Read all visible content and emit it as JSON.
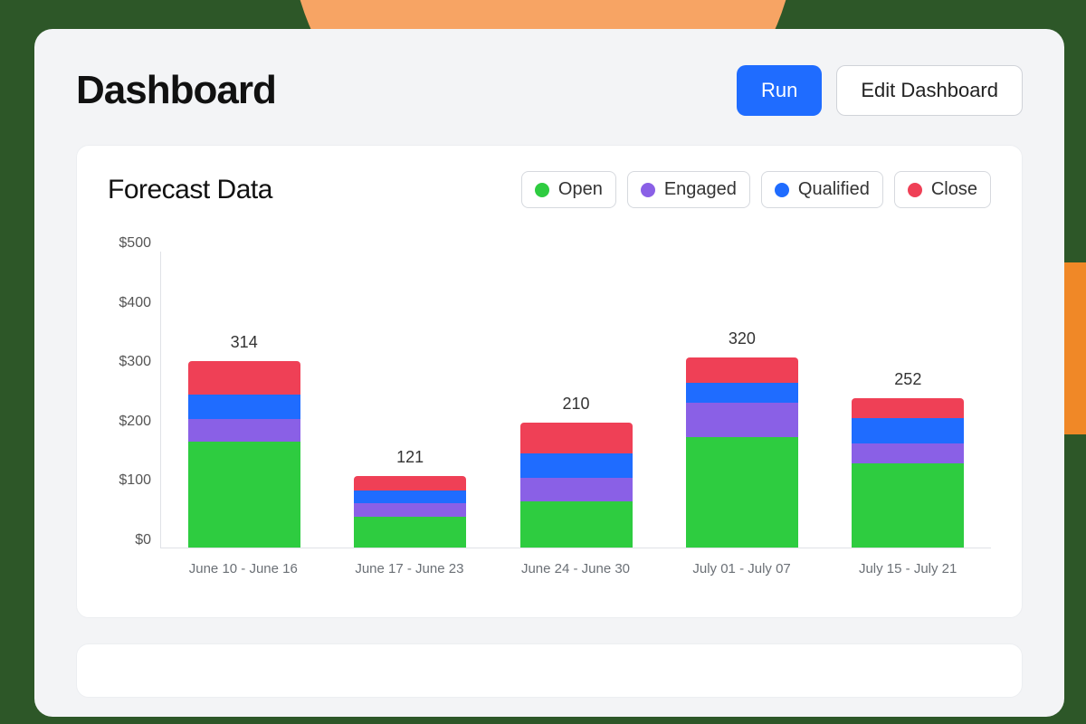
{
  "header": {
    "title": "Dashboard",
    "run_label": "Run",
    "edit_label": "Edit Dashboard"
  },
  "chart": {
    "title": "Forecast Data",
    "legend": [
      {
        "name": "Open",
        "color": "#2ecc40"
      },
      {
        "name": "Engaged",
        "color": "#8a60e6"
      },
      {
        "name": "Qualified",
        "color": "#1f6cff"
      },
      {
        "name": "Close",
        "color": "#ef4056"
      }
    ],
    "y_ticks": [
      "$500",
      "$400",
      "$300",
      "$200",
      "$100",
      "$0"
    ]
  },
  "chart_data": {
    "type": "bar",
    "title": "Forecast Data",
    "xlabel": "",
    "ylabel": "",
    "ylim": [
      0,
      500
    ],
    "categories": [
      "June 10 - June 16",
      "June 17 - June 23",
      "June 24 - June 30",
      "July 01 - July 07",
      "July 15 - July 21"
    ],
    "totals": [
      314,
      121,
      210,
      320,
      252
    ],
    "series": [
      {
        "name": "Open",
        "color": "#2ecc40",
        "values": [
          178,
          52,
          78,
          186,
          142
        ]
      },
      {
        "name": "Engaged",
        "color": "#8a60e6",
        "values": [
          38,
          22,
          40,
          58,
          34
        ]
      },
      {
        "name": "Qualified",
        "color": "#1f6cff",
        "values": [
          42,
          22,
          40,
          34,
          42
        ]
      },
      {
        "name": "Close",
        "color": "#ef4056",
        "values": [
          56,
          25,
          52,
          42,
          34
        ]
      }
    ]
  }
}
